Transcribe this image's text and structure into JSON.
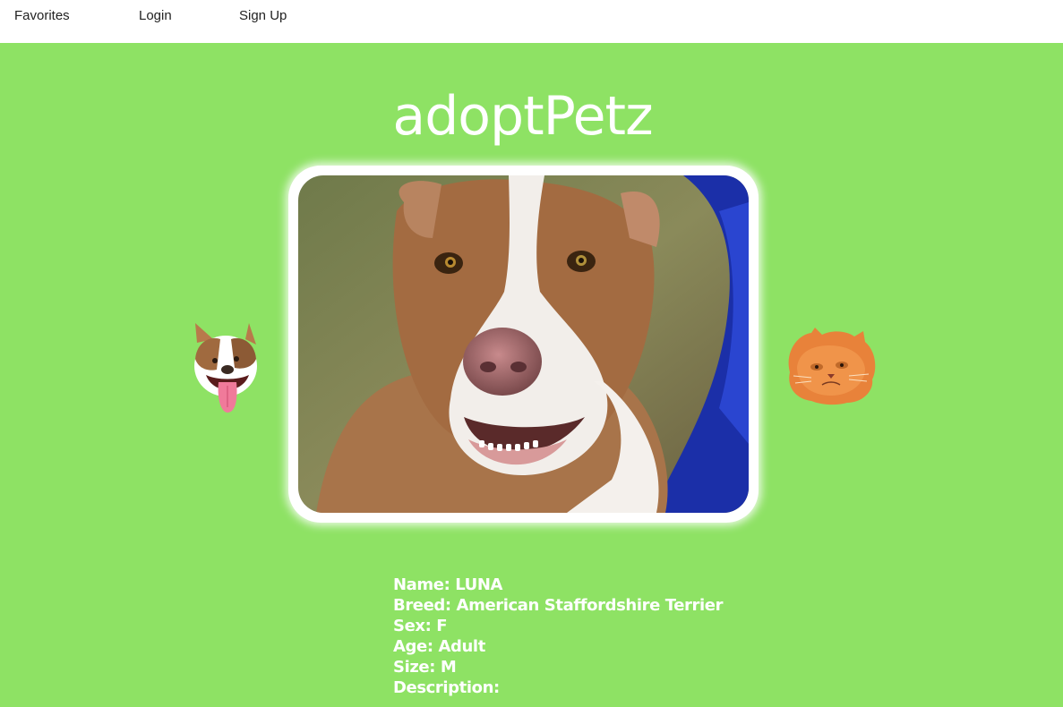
{
  "nav": {
    "favorites": "Favorites",
    "login": "Login",
    "signup": "Sign Up"
  },
  "app": {
    "title": "adoptPetz"
  },
  "colors": {
    "background": "#8ee264",
    "nav_background": "#ffffff",
    "text_on_green": "#ffffff"
  },
  "featured_pet": {
    "photo": "dog-photo",
    "name_line": "Name: LUNA",
    "breed_line": "Breed: American Staffordshire Terrier",
    "sex_line": "Sex: F",
    "age_line": "Age: Adult",
    "size_line": "Size: M",
    "description_line": "Description:"
  },
  "side_icons": {
    "left": "dog-icon",
    "right": "cat-icon"
  }
}
